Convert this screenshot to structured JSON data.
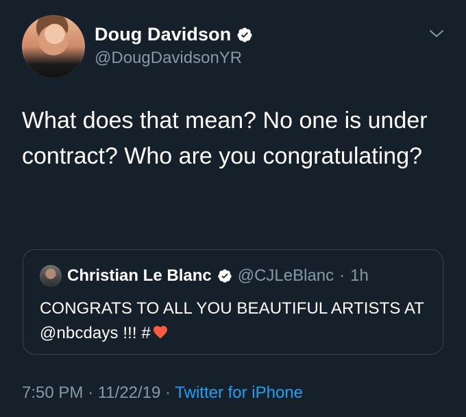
{
  "user": {
    "display_name": "Doug Davidson",
    "handle": "@DougDavidsonYR",
    "verified": true
  },
  "tweet": {
    "text": "What does that mean? No one is under contract? Who are you congratulating?"
  },
  "quoted_tweet": {
    "display_name": "Christian Le Blanc",
    "handle": "@CJLeBlanc",
    "separator": "·",
    "time": "1h",
    "text": "CONGRATS TO ALL YOU BEAUTIFUL ARTISTS AT @nbcdays !!! #",
    "emoji": "heart"
  },
  "metadata": {
    "time": "7:50 PM",
    "separator_1": "·",
    "date": "11/22/19",
    "separator_2": "·",
    "source": "Twitter for iPhone"
  },
  "icons": {
    "verified": "verified-badge-icon",
    "menu": "chevron-down-icon",
    "emoji": "heart-icon"
  },
  "colors": {
    "background": "#15202b",
    "text": "#ffffff",
    "secondary_text": "#8899a6",
    "link": "#1da1f2",
    "border": "#38444d",
    "verified_badge": "#ffffff",
    "heart": "#ff5a43"
  }
}
